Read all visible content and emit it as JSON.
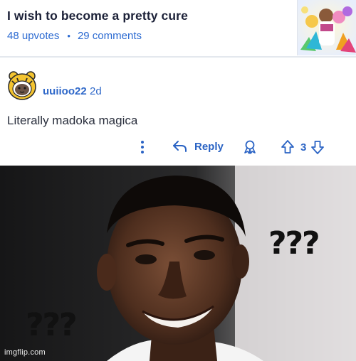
{
  "post": {
    "title": "I wish to become a pretty cure",
    "upvotes": "48 upvotes",
    "separator": "•",
    "comments": "29 comments"
  },
  "comment": {
    "username": "uuiioo22",
    "age": "2d",
    "body": "Literally madoka magica",
    "actions": {
      "reply_label": "Reply",
      "vote_count": "3"
    }
  },
  "meme": {
    "caption_right": "???",
    "caption_left": "???",
    "watermark": "imgflip.com"
  },
  "icons": {
    "more": "more-vertical-icon",
    "reply": "reply-arrow-icon",
    "award": "award-icon",
    "upvote": "upvote-arrow-icon",
    "downvote": "downvote-arrow-icon"
  },
  "colors": {
    "link_blue": "#2f68c9",
    "title_dark": "#1c2138",
    "divider": "#e4e8ee"
  }
}
